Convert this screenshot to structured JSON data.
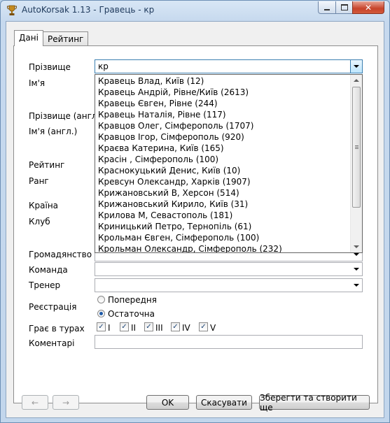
{
  "window": {
    "title": "AutoKorsak 1.13 - Гравець - кр",
    "icon": "trophy-icon",
    "controls": {
      "minimize": "minimize-icon",
      "maximize": "maximize-icon",
      "close": "close-icon"
    }
  },
  "tabs": [
    {
      "label": "Дані",
      "active": true
    },
    {
      "label": "Рейтинг",
      "active": false
    }
  ],
  "form": {
    "surname_label": "Прізвище",
    "surname_value": "кр",
    "name_label": "Ім'я",
    "surname_en_label": "Прізвище (англ.)",
    "name_en_label": "Ім'я (англ.)",
    "rating_label": "Рейтинг",
    "rank_label": "Ранг",
    "country_label": "Країна",
    "club_label": "Клуб",
    "citizenship_label": "Громадянство",
    "team_label": "Команда",
    "coach_label": "Тренер",
    "registration_label": "Реєстрація",
    "registration_options": [
      "Попередня",
      "Остаточна"
    ],
    "registration_selected": "Остаточна",
    "rounds_label": "Грає в турах",
    "rounds": [
      "I",
      "II",
      "III",
      "IV",
      "V"
    ],
    "comments_label": "Коментарі"
  },
  "dropdown_items": [
    "Кравець Влад, Київ (12)",
    "Кравець Андрій, Рівне/Київ (2613)",
    "Кравець Євген, Рівне (244)",
    "Кравець Наталія, Рівне (117)",
    "Кравцов Олег, Сімферополь (1707)",
    "Кравцов Ігор, Сімферополь (920)",
    "Краєва Катерина, Київ (165)",
    "Красін , Сімферополь (100)",
    "Краснокуцький Денис, Київ (10)",
    "Кревсун Олександр, Харків (1907)",
    "Крижановський В, Херсон (514)",
    "Крижановський Кирило, Київ (31)",
    "Крилова М, Севастополь (181)",
    "Криницький Петро, Тернопіль (61)",
    "Крольман Євген, Сімферополь (100)",
    "Крольман Олександр, Сімферополь (232)"
  ],
  "buttons": {
    "back": "←",
    "forward": "→",
    "ok": "OK",
    "cancel": "Скасувати",
    "save_and_new": "Зберегти та створити ще"
  }
}
